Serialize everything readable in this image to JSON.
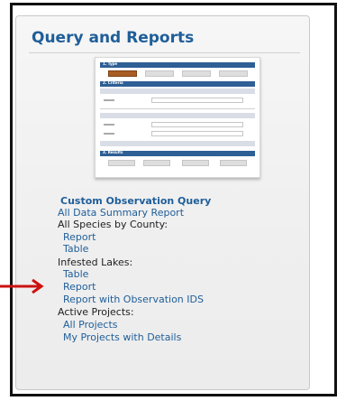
{
  "panel": {
    "title": "Query and Reports"
  },
  "thumbnail": {
    "sections": [
      "1. Type",
      "2. Criteria",
      "3. Results"
    ]
  },
  "links": {
    "custom_query": "Custom Observation Query",
    "all_data_summary": "All Data Summary Report",
    "species_county_heading": "All Species by County:",
    "species_county_report": "Report",
    "species_county_table": "Table",
    "infested_heading": "Infested Lakes:",
    "infested_table": "Table",
    "infested_report": "Report",
    "infested_report_ids": "Report with Observation IDS",
    "active_projects_heading": "Active Projects:",
    "all_projects": "All Projects",
    "my_projects": "My Projects with Details"
  },
  "colors": {
    "link": "#1f5e99",
    "arrow": "#cc1111",
    "thumb_header": "#2e5f95",
    "thumb_active_button": "#a85d23"
  }
}
